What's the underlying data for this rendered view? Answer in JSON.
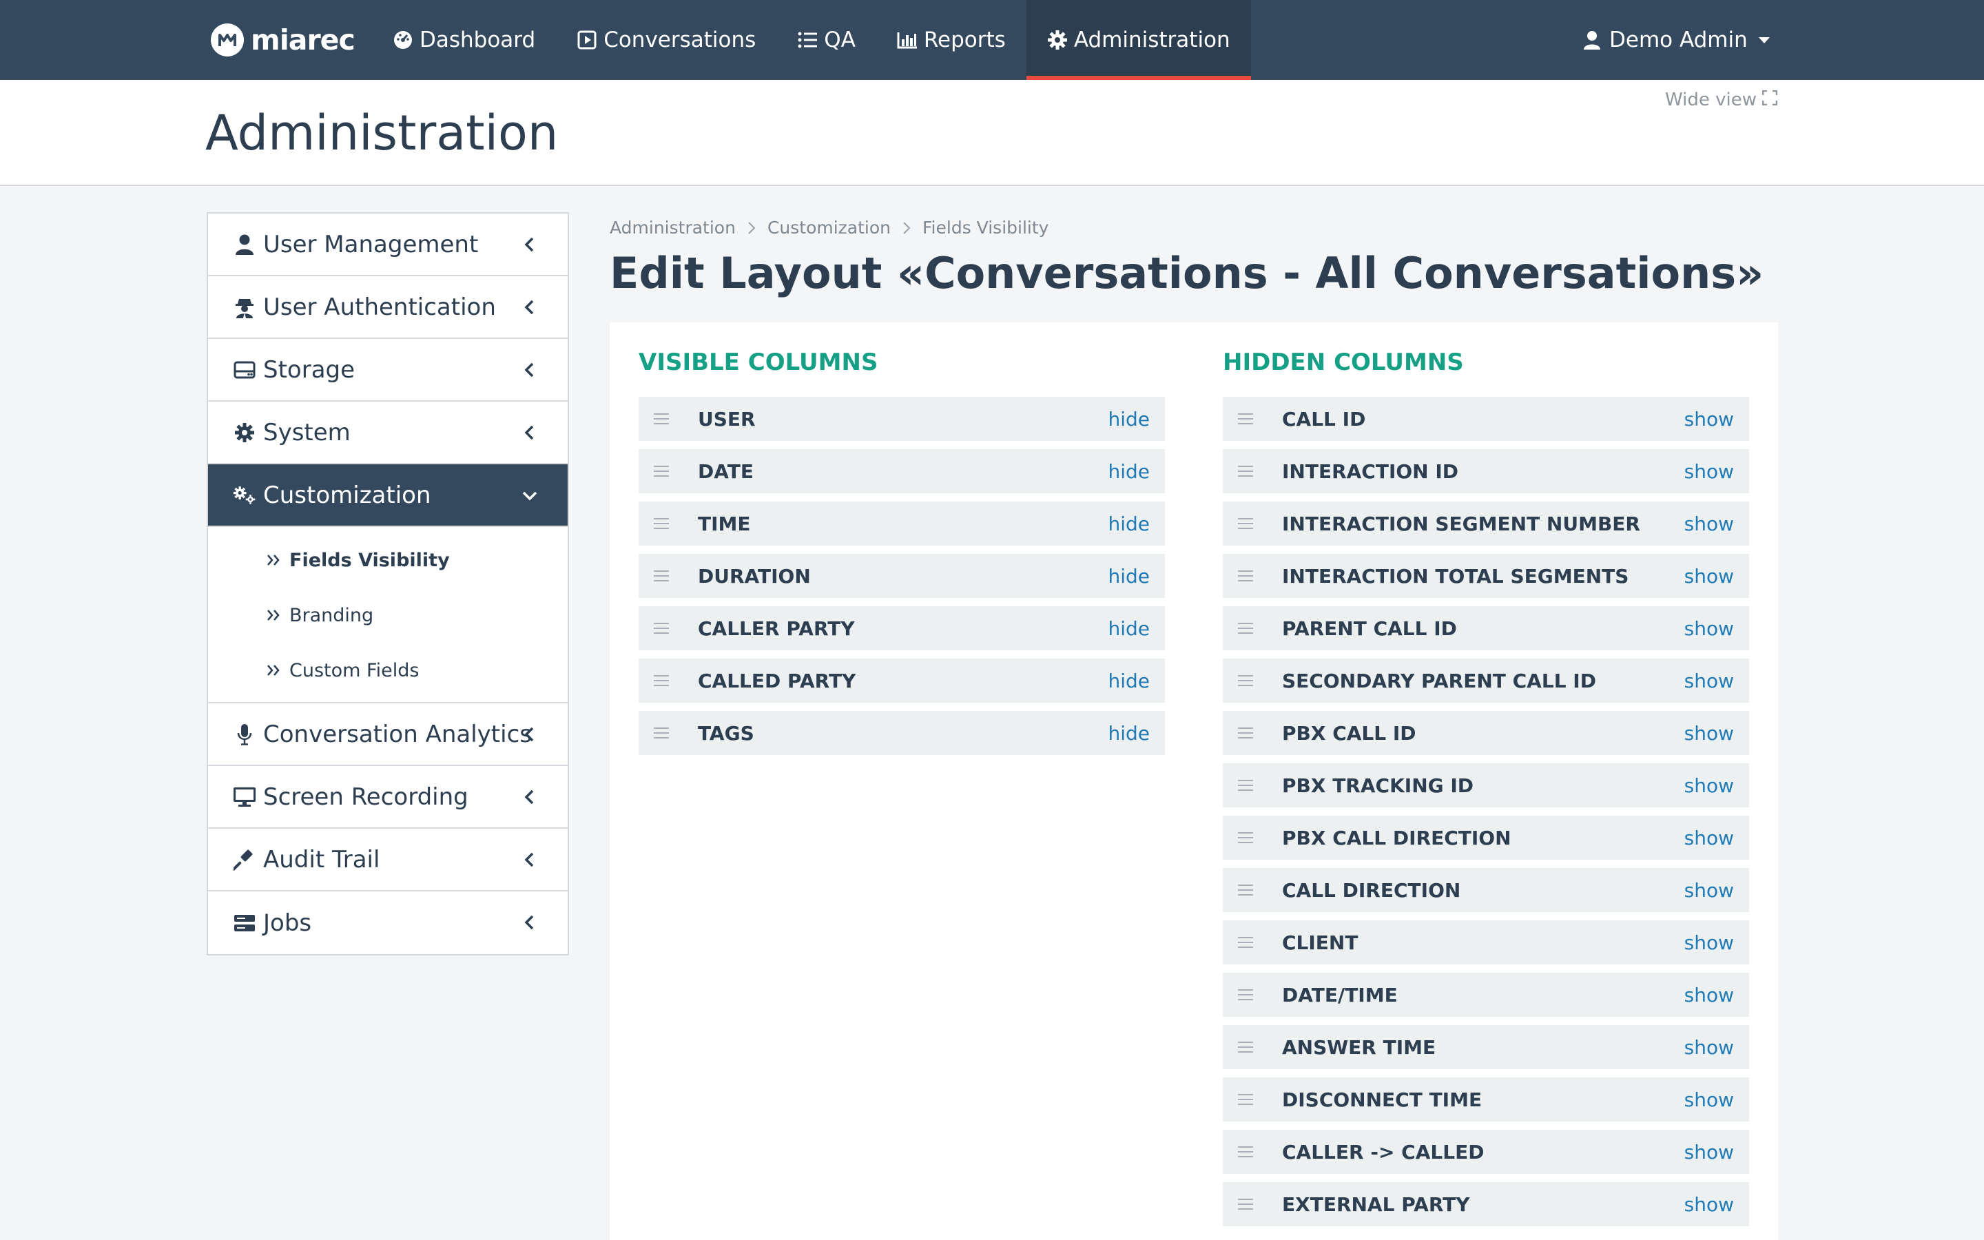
{
  "navbar": {
    "brand": "miarec",
    "items": [
      {
        "label": "Dashboard",
        "icon": "dashboard-icon"
      },
      {
        "label": "Conversations",
        "icon": "play-square-icon"
      },
      {
        "label": "QA",
        "icon": "list-icon"
      },
      {
        "label": "Reports",
        "icon": "bar-chart-icon"
      },
      {
        "label": "Administration",
        "icon": "gear-icon",
        "active": true
      }
    ],
    "user": "Demo Admin"
  },
  "header": {
    "title": "Administration",
    "wide_view": "Wide view"
  },
  "sidebar": {
    "items": [
      {
        "label": "User Management",
        "icon": "user-icon"
      },
      {
        "label": "User Authentication",
        "icon": "user-secret-icon"
      },
      {
        "label": "Storage",
        "icon": "hdd-icon"
      },
      {
        "label": "System",
        "icon": "gear-icon"
      },
      {
        "label": "Customization",
        "icon": "gears-icon",
        "active": true
      },
      {
        "label": "Conversation Analytics",
        "icon": "microphone-icon"
      },
      {
        "label": "Screen Recording",
        "icon": "monitor-icon"
      },
      {
        "label": "Audit Trail",
        "icon": "gavel-icon"
      },
      {
        "label": "Jobs",
        "icon": "server-icon"
      }
    ],
    "submenu": [
      {
        "label": "Fields Visibility",
        "current": true
      },
      {
        "label": "Branding"
      },
      {
        "label": "Custom Fields"
      }
    ]
  },
  "breadcrumb": [
    "Administration",
    "Customization",
    "Fields Visibility"
  ],
  "main": {
    "title": "Edit Layout «Conversations - All Conversations»",
    "visible": {
      "heading": "VISIBLE COLUMNS",
      "action": "hide",
      "fields": [
        "USER",
        "DATE",
        "TIME",
        "DURATION",
        "CALLER PARTY",
        "CALLED PARTY",
        "TAGS"
      ]
    },
    "hidden": {
      "heading": "HIDDEN COLUMNS",
      "action": "show",
      "fields": [
        "CALL ID",
        "INTERACTION ID",
        "INTERACTION SEGMENT NUMBER",
        "INTERACTION TOTAL SEGMENTS",
        "PARENT CALL ID",
        "SECONDARY PARENT CALL ID",
        "PBX CALL ID",
        "PBX TRACKING ID",
        "PBX CALL DIRECTION",
        "CALL DIRECTION",
        "CLIENT",
        "DATE/TIME",
        "ANSWER TIME",
        "DISCONNECT TIME",
        "CALLER -> CALLED",
        "EXTERNAL PARTY"
      ]
    }
  },
  "colors": {
    "navbar": "#34495e",
    "active_underline": "#e74c3c",
    "heading_green": "#16a085",
    "link_blue": "#1f7ab5"
  }
}
